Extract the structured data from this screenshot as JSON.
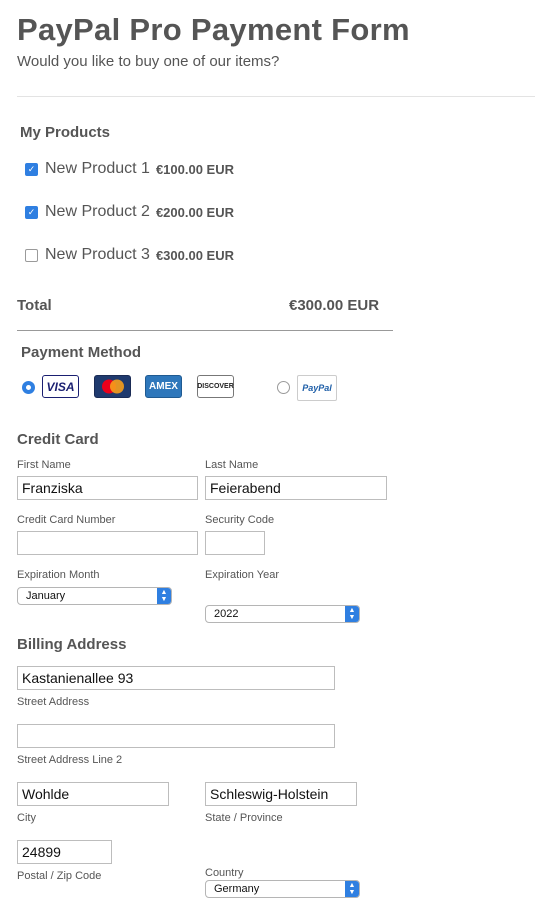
{
  "header": {
    "title": "PayPal Pro Payment Form",
    "subtitle": "Would you like to buy one of our items?"
  },
  "products": {
    "heading": "My Products",
    "items": [
      {
        "name": "New Product 1",
        "price": "€100.00 EUR",
        "checked": true
      },
      {
        "name": "New Product 2",
        "price": "€200.00 EUR",
        "checked": true
      },
      {
        "name": "New Product 3",
        "price": "€300.00 EUR",
        "checked": false
      }
    ],
    "total_label": "Total",
    "total_value": "€300.00 EUR"
  },
  "payment": {
    "heading": "Payment Method",
    "cards": [
      {
        "name": "visa",
        "label": "VISA",
        "color": "#1a1f71"
      },
      {
        "name": "mastercard",
        "label": "MasterCard",
        "color": "#eb001b"
      },
      {
        "name": "amex",
        "label": "AMEX",
        "color": "#2e77bb"
      },
      {
        "name": "discover",
        "label": "DISCOVER",
        "color": "#f58220"
      }
    ],
    "paypal_label": "PayPal",
    "selected": "card"
  },
  "credit_card": {
    "heading": "Credit Card",
    "first_name_label": "First Name",
    "first_name_value": "Franziska",
    "last_name_label": "Last Name",
    "last_name_value": "Feierabend",
    "number_label": "Credit Card Number",
    "number_value": "",
    "security_label": "Security Code",
    "security_value": "",
    "exp_month_label": "Expiration Month",
    "exp_month_value": "January",
    "exp_year_label": "Expiration Year",
    "exp_year_value": "2022"
  },
  "billing": {
    "heading": "Billing Address",
    "street_value": "Kastanienallee 93",
    "street_label": "Street Address",
    "street2_value": "",
    "street2_label": "Street Address Line 2",
    "city_value": "Wohlde",
    "city_label": "City",
    "state_value": "Schleswig-Holstein",
    "state_label": "State / Province",
    "zip_value": "24899",
    "zip_label": "Postal / Zip Code",
    "country_value": "Germany",
    "country_label": "Country"
  }
}
